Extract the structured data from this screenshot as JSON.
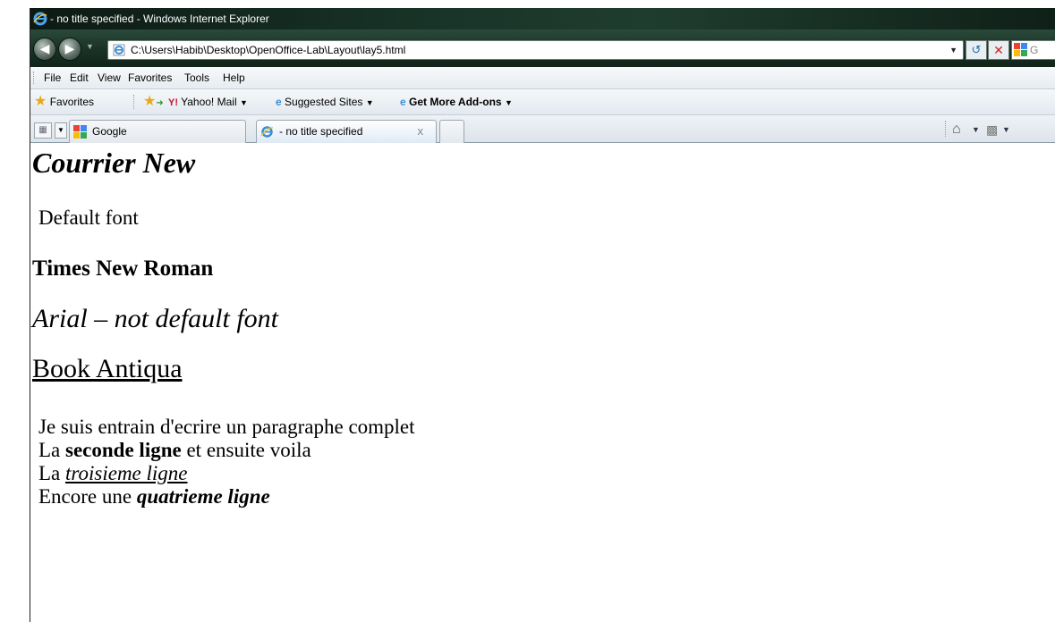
{
  "window": {
    "title": "- no title specified - Windows Internet Explorer"
  },
  "address_bar": {
    "url": "C:\\Users\\Habib\\Desktop\\OpenOffice-Lab\\Layout\\lay5.html",
    "search_placeholder": "G"
  },
  "menu": {
    "items": [
      "File",
      "Edit",
      "View",
      "Favorites",
      "Tools",
      "Help"
    ]
  },
  "favorites_bar": {
    "favorites_label": "Favorites",
    "items": [
      "Yahoo! Mail",
      "Suggested Sites",
      "Get More Add-ons"
    ]
  },
  "tabs": [
    {
      "label": "Google",
      "icon": "google-icon"
    },
    {
      "label": "- no title specified",
      "icon": "ie-page-icon",
      "active": true
    }
  ],
  "tab_close_glyph": "x",
  "content": {
    "heading_courrier": "Courrier New",
    "default_font": "Default font",
    "times": "Times New Roman",
    "arial": "Arial – not default font",
    "antiqua": "Book Antiqua",
    "paragraph": {
      "line1": "Je suis entrain d'ecrire un paragraphe complet",
      "line2_a": "La ",
      "line2_b": "seconde ligne",
      "line2_c": " et ensuite voila",
      "line3_a": "La ",
      "line3_b": "troisieme ligne",
      "line4_a": "Encore une ",
      "line4_b": "quatrieme ligne"
    }
  },
  "colors": {
    "titlebar": "#173126",
    "active_tab": "#dfeaf5",
    "stop": "#d0241c",
    "refresh": "#2a6fb0"
  }
}
